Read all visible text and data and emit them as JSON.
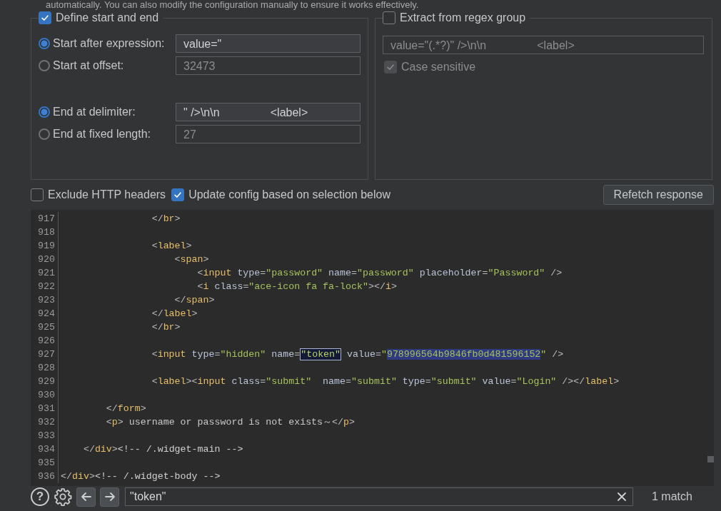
{
  "intro_text": "automatically. You can also modify the configuration manually to ensure it works effectively.",
  "define_group": {
    "label": "Define start and end",
    "checked": true,
    "rows": [
      {
        "label": "Start after expression:",
        "selected": true,
        "value": "value=\"",
        "disabled": false,
        "gap_before": false
      },
      {
        "label": "Start at offset:",
        "selected": false,
        "value": "32473",
        "disabled": true,
        "gap_before": false
      },
      {
        "label": "End at delimiter:",
        "selected": true,
        "value": "\" />\\n\\n                <label>",
        "disabled": false,
        "gap_before": true
      },
      {
        "label": "End at fixed length:",
        "selected": false,
        "value": "27",
        "disabled": true,
        "gap_before": false
      }
    ]
  },
  "regex_group": {
    "label": "Extract from regex group",
    "checked": false,
    "pattern": {
      "value": "value=\"(.*?)\" />\\n\\n                <label>",
      "disabled": true
    },
    "case_sensitive": {
      "label": "Case sensitive",
      "checked": true,
      "disabled": true
    }
  },
  "options": [
    {
      "label": "Exclude HTTP headers",
      "checked": false
    },
    {
      "label": "Update config based on selection below",
      "checked": true
    }
  ],
  "refetch_button": "Refetch response",
  "code_lines": [
    {
      "number": "917",
      "tokens": [
        {
          "kind": "punct",
          "text": "                </"
        },
        {
          "kind": "tag",
          "text": "br"
        },
        {
          "kind": "punct",
          "text": ">"
        }
      ]
    },
    {
      "number": "918"
    },
    {
      "number": "919",
      "tokens": [
        {
          "kind": "punct",
          "text": "                <"
        },
        {
          "kind": "tag",
          "text": "label"
        },
        {
          "kind": "punct",
          "text": ">"
        }
      ]
    },
    {
      "number": "920",
      "tokens": [
        {
          "kind": "punct",
          "text": "                    <"
        },
        {
          "kind": "tag",
          "text": "span"
        },
        {
          "kind": "punct",
          "text": ">"
        }
      ]
    },
    {
      "number": "921",
      "tokens": [
        {
          "kind": "punct",
          "text": "                        <"
        },
        {
          "kind": "tag",
          "text": "input"
        },
        {
          "kind": "attr",
          "text": " type"
        },
        {
          "kind": "punct",
          "text": "="
        },
        {
          "kind": "str",
          "text": "\"password\""
        },
        {
          "kind": "attr",
          "text": " name"
        },
        {
          "kind": "punct",
          "text": "="
        },
        {
          "kind": "str",
          "text": "\"password\""
        },
        {
          "kind": "attr",
          "text": " placeholder"
        },
        {
          "kind": "punct",
          "text": "="
        },
        {
          "kind": "str",
          "text": "\"Password\""
        },
        {
          "kind": "punct",
          "text": " />"
        }
      ]
    },
    {
      "number": "922",
      "tokens": [
        {
          "kind": "punct",
          "text": "                        <"
        },
        {
          "kind": "tag",
          "text": "i"
        },
        {
          "kind": "attr",
          "text": " class"
        },
        {
          "kind": "punct",
          "text": "="
        },
        {
          "kind": "str",
          "text": "\"ace-icon fa fa-lock\""
        },
        {
          "kind": "punct",
          "text": "></"
        },
        {
          "kind": "tag",
          "text": "i"
        },
        {
          "kind": "punct",
          "text": ">"
        }
      ]
    },
    {
      "number": "923",
      "tokens": [
        {
          "kind": "punct",
          "text": "                    </"
        },
        {
          "kind": "tag",
          "text": "span"
        },
        {
          "kind": "punct",
          "text": ">"
        }
      ]
    },
    {
      "number": "924",
      "tokens": [
        {
          "kind": "punct",
          "text": "                </"
        },
        {
          "kind": "tag",
          "text": "label"
        },
        {
          "kind": "punct",
          "text": ">"
        }
      ]
    },
    {
      "number": "925",
      "tokens": [
        {
          "kind": "punct",
          "text": "                </"
        },
        {
          "kind": "tag",
          "text": "br"
        },
        {
          "kind": "punct",
          "text": ">"
        }
      ]
    },
    {
      "number": "926"
    },
    {
      "number": "927",
      "tokens": [
        {
          "kind": "punct",
          "text": "                <"
        },
        {
          "kind": "tag",
          "text": "input"
        },
        {
          "kind": "attr",
          "text": " type"
        },
        {
          "kind": "punct",
          "text": "="
        },
        {
          "kind": "str",
          "text": "\"hidden\""
        },
        {
          "kind": "attr",
          "text": " name"
        },
        {
          "kind": "punct",
          "text": "="
        },
        {
          "kind": "str",
          "text": "\"token\"",
          "search_match": true
        },
        {
          "kind": "attr",
          "text": " value"
        },
        {
          "kind": "punct",
          "text": "="
        },
        {
          "kind": "str",
          "text": "\""
        },
        {
          "kind": "str",
          "text": "978996564b9846fb0d481596152",
          "selected": true
        },
        {
          "kind": "str",
          "text": "\""
        },
        {
          "kind": "punct",
          "text": " />"
        }
      ]
    },
    {
      "number": "928"
    },
    {
      "number": "929",
      "tokens": [
        {
          "kind": "punct",
          "text": "                <"
        },
        {
          "kind": "tag",
          "text": "label"
        },
        {
          "kind": "punct",
          "text": "><"
        },
        {
          "kind": "tag",
          "text": "input"
        },
        {
          "kind": "attr",
          "text": " class"
        },
        {
          "kind": "punct",
          "text": "="
        },
        {
          "kind": "str",
          "text": "\"submit\""
        },
        {
          "kind": "attr",
          "text": "  name"
        },
        {
          "kind": "punct",
          "text": "="
        },
        {
          "kind": "str",
          "text": "\"submit\""
        },
        {
          "kind": "attr",
          "text": " type"
        },
        {
          "kind": "punct",
          "text": "="
        },
        {
          "kind": "str",
          "text": "\"submit\""
        },
        {
          "kind": "attr",
          "text": " value"
        },
        {
          "kind": "punct",
          "text": "="
        },
        {
          "kind": "str",
          "text": "\"Login\""
        },
        {
          "kind": "punct",
          "text": " /></"
        },
        {
          "kind": "tag",
          "text": "label"
        },
        {
          "kind": "punct",
          "text": ">"
        }
      ]
    },
    {
      "number": "930"
    },
    {
      "number": "931",
      "tokens": [
        {
          "kind": "punct",
          "text": "        </"
        },
        {
          "kind": "tag",
          "text": "form"
        },
        {
          "kind": "punct",
          "text": ">"
        }
      ]
    },
    {
      "number": "932",
      "tokens": [
        {
          "kind": "punct",
          "text": "        <"
        },
        {
          "kind": "tag",
          "text": "p"
        },
        {
          "kind": "punct",
          "text": ">"
        },
        {
          "kind": "text",
          "text": " username or password is not exists～"
        },
        {
          "kind": "punct",
          "text": "</"
        },
        {
          "kind": "tag",
          "text": "p"
        },
        {
          "kind": "punct",
          "text": ">"
        }
      ]
    },
    {
      "number": "933"
    },
    {
      "number": "934",
      "tokens": [
        {
          "kind": "punct",
          "text": "    </"
        },
        {
          "kind": "tag",
          "text": "div"
        },
        {
          "kind": "punct",
          "text": ">"
        },
        {
          "kind": "comment",
          "text": "<!-- /.widget-main -->"
        }
      ]
    },
    {
      "number": "935"
    },
    {
      "number": "936",
      "tokens": [
        {
          "kind": "punct",
          "text": "</"
        },
        {
          "kind": "tag",
          "text": "div"
        },
        {
          "kind": "punct",
          "text": ">"
        },
        {
          "kind": "comment",
          "text": "<!-- /.widget-body -->"
        }
      ]
    }
  ],
  "search_bar": {
    "help": "?",
    "query": "\"token\"",
    "result": "1 match"
  }
}
